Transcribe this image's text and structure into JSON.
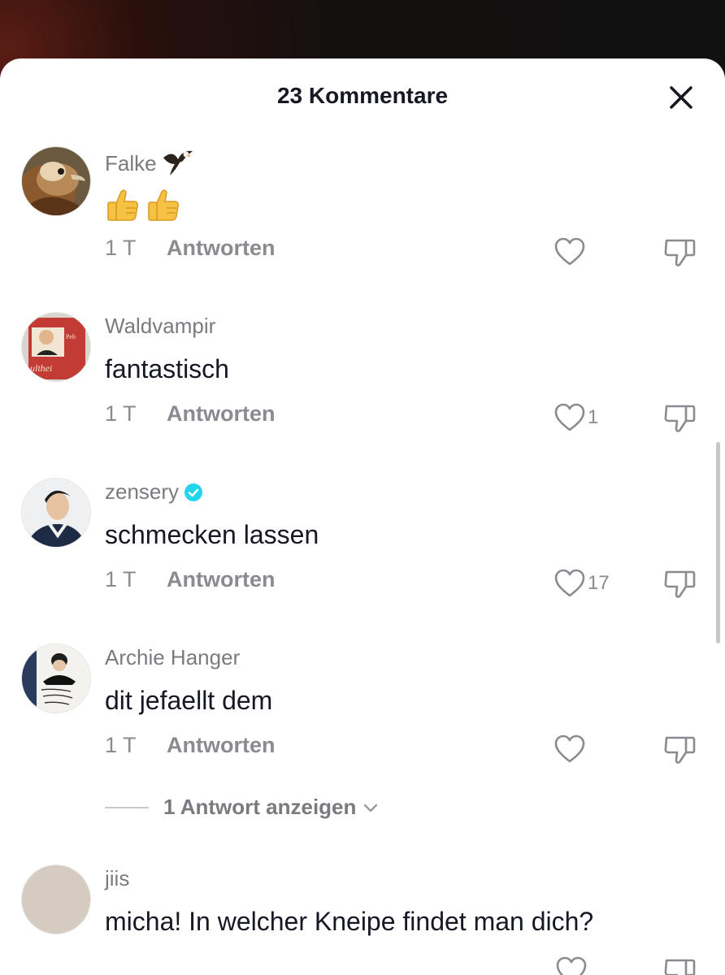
{
  "sheet": {
    "title": "23 Kommentare",
    "close_icon": "close-icon"
  },
  "comments": [
    {
      "username": "Falke",
      "username_emoji": "eagle",
      "text": "",
      "emojis": [
        "thumbs-up",
        "thumbs-up"
      ],
      "time": "1 T",
      "reply_label": "Antworten",
      "likes": ""
    },
    {
      "username": "Waldvampir",
      "text": "fantastisch",
      "time": "1 T",
      "reply_label": "Antworten",
      "likes": "1"
    },
    {
      "username": "zensery",
      "verified": true,
      "text": "schmecken lassen",
      "time": "1 T",
      "reply_label": "Antworten",
      "likes": "17"
    },
    {
      "username": "Archie Hanger",
      "text": "dit jefaellt dem",
      "time": "1 T",
      "reply_label": "Antworten",
      "likes": "",
      "replies_label": "1 Antwort anzeigen"
    },
    {
      "username": "jiis",
      "text": "micha! In welcher Kneipe findet man dich?"
    }
  ],
  "colors": {
    "primary_text": "#161823",
    "secondary_text": "#8a8b91",
    "verified_badge": "#20d5ec",
    "sheet_bg": "#ffffff"
  }
}
